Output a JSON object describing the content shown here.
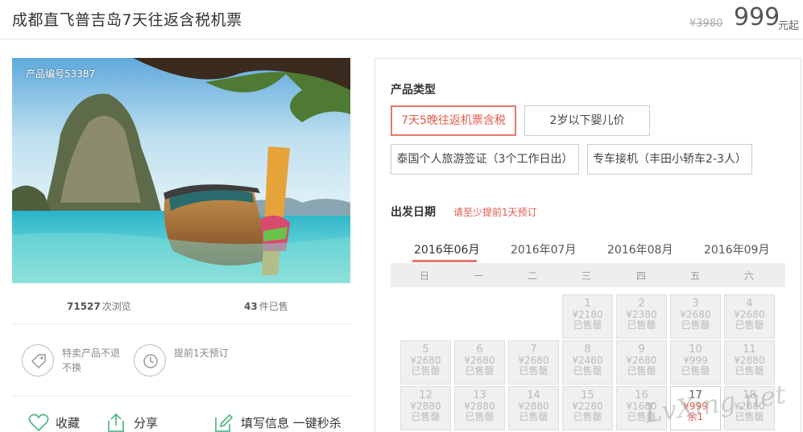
{
  "product": {
    "title": "成都直飞普吉岛7天往返含税机票",
    "old_price": "¥3980",
    "price": "999",
    "price_unit": "元起",
    "id_label": "产品编号53387"
  },
  "stats": {
    "views_num": "71527",
    "views_label": "次浏览",
    "sold_num": "43",
    "sold_label": "件已售"
  },
  "features": [
    {
      "icon": "price-tag-icon",
      "text": "特卖产品不退不换"
    },
    {
      "icon": "clock-icon",
      "text": "提前1天预订"
    }
  ],
  "actions": {
    "favorite": "收藏",
    "share": "分享",
    "fill": "填写信息 一键秒杀"
  },
  "panel": {
    "type_title": "产品类型",
    "options": [
      "7天5晚往返机票含税",
      "2岁以下婴儿价",
      "泰国个人旅游签证（3个工作日出）",
      "专车接机（丰田小轿车2-3人）"
    ],
    "selected_option": 0,
    "date_title": "出发日期",
    "date_note": "请至少提前1天预订",
    "months": [
      "2016年06月",
      "2016年07月",
      "2016年08月",
      "2016年09月"
    ],
    "active_month": 0,
    "weekdays": [
      "日",
      "一",
      "二",
      "三",
      "四",
      "五",
      "六"
    ],
    "days": [
      {
        "d": "1",
        "p": "¥2180",
        "s": "已售罄"
      },
      {
        "d": "2",
        "p": "¥2380",
        "s": "已售罄"
      },
      {
        "d": "3",
        "p": "¥2680",
        "s": "已售罄"
      },
      {
        "d": "4",
        "p": "¥2680",
        "s": "已售罄"
      },
      {
        "d": "5",
        "p": "¥2680",
        "s": "已售罄"
      },
      {
        "d": "6",
        "p": "¥2680",
        "s": "已售罄"
      },
      {
        "d": "7",
        "p": "¥2680",
        "s": "已售罄"
      },
      {
        "d": "8",
        "p": "¥2480",
        "s": "已售罄"
      },
      {
        "d": "9",
        "p": "¥2680",
        "s": "已售罄"
      },
      {
        "d": "10",
        "p": "¥999",
        "s": "已售罄"
      },
      {
        "d": "11",
        "p": "¥2880",
        "s": "已售罄"
      },
      {
        "d": "12",
        "p": "¥2880",
        "s": "已售罄"
      },
      {
        "d": "13",
        "p": "¥2880",
        "s": "已售罄"
      },
      {
        "d": "14",
        "p": "¥2880",
        "s": "已售罄"
      },
      {
        "d": "15",
        "p": "¥2280",
        "s": "已售罄"
      },
      {
        "d": "16",
        "p": "¥1680",
        "s": "已售罄"
      },
      {
        "d": "17",
        "p": "¥999",
        "s": "余1"
      },
      {
        "d": "18",
        "p": "¥2880",
        "s": "已售罄"
      }
    ]
  },
  "watermark": "LvXing.net"
}
